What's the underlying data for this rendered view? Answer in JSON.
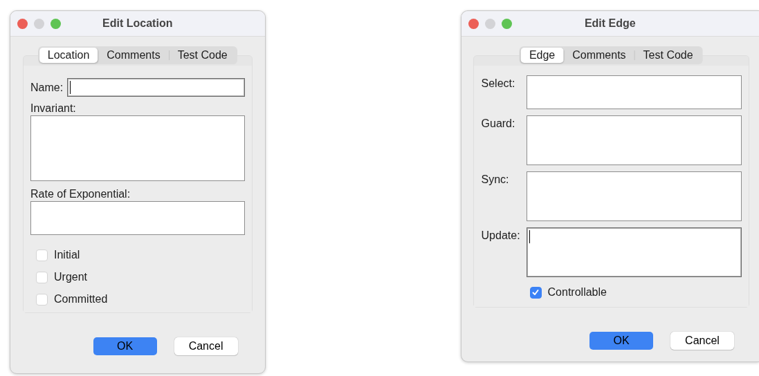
{
  "windows": [
    {
      "title": "Edit Location",
      "tabs": [
        {
          "label": "Location",
          "selected": true
        },
        {
          "label": "Comments",
          "selected": false
        },
        {
          "label": "Test Code",
          "selected": false
        }
      ],
      "fields": [
        {
          "kind": "line",
          "label": "Name:",
          "focused": true
        },
        {
          "kind": "area_below",
          "label": "Invariant:",
          "focused": false
        },
        {
          "kind": "area_below",
          "label": "Rate of Exponential:",
          "focused": false
        }
      ],
      "checkboxes": [
        {
          "label": "Initial",
          "checked": false
        },
        {
          "label": "Urgent",
          "checked": false
        },
        {
          "label": "Committed",
          "checked": false
        }
      ],
      "buttons": [
        {
          "label": "OK",
          "kind": "default"
        },
        {
          "label": "Cancel",
          "kind": "plain"
        }
      ]
    },
    {
      "title": "Edit Edge",
      "tabs": [
        {
          "label": "Edge",
          "selected": true
        },
        {
          "label": "Comments",
          "selected": false
        },
        {
          "label": "Test Code",
          "selected": false
        }
      ],
      "fields": [
        {
          "kind": "area_side",
          "label": "Select:",
          "focused": false
        },
        {
          "kind": "area_side",
          "label": "Guard:",
          "focused": false
        },
        {
          "kind": "area_side",
          "label": "Sync:",
          "focused": false
        },
        {
          "kind": "area_side",
          "label": "Update:",
          "focused": true
        }
      ],
      "checkboxes": [
        {
          "label": "Controllable",
          "checked": true
        }
      ],
      "buttons": [
        {
          "label": "OK",
          "kind": "default"
        },
        {
          "label": "Cancel",
          "kind": "plain"
        }
      ]
    }
  ]
}
